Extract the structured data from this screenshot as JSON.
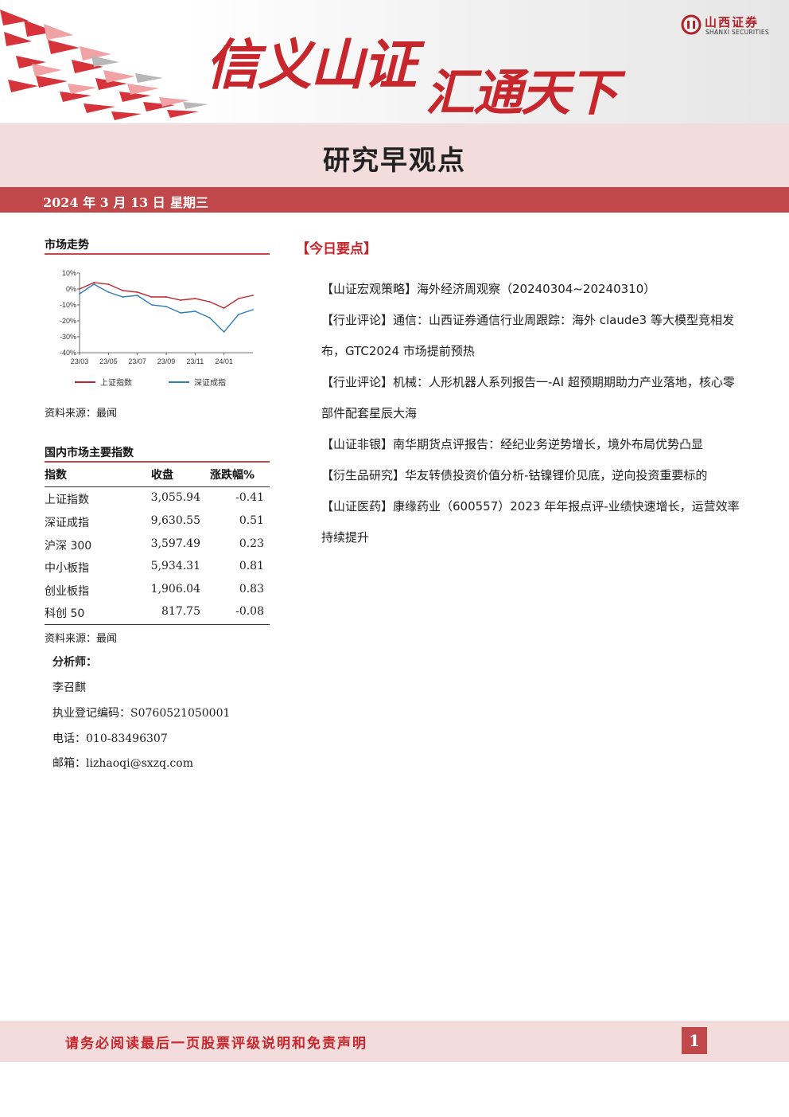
{
  "banner": {
    "slogan_left": "信义山证",
    "slogan_right": "汇通天下",
    "logo_name": "山西证券",
    "logo_sub": "SHANXI SECURITIES"
  },
  "report_title": "研究早观点",
  "date_line": {
    "date": "2024 年 3 月 13 日",
    "weekday": "星期三"
  },
  "market_trend": {
    "heading": "市场走势",
    "source": "资料来源：最闻",
    "chart_data": {
      "type": "line",
      "x": [
        "23/03",
        "23/04",
        "23/05",
        "23/06",
        "23/07",
        "23/08",
        "23/09",
        "23/10",
        "23/11",
        "23/12",
        "24/01",
        "24/02",
        "24/03"
      ],
      "xticks": [
        "23/03",
        "23/05",
        "23/07",
        "23/09",
        "23/11",
        "24/01"
      ],
      "yticks": [
        "10%",
        "0%",
        "-10%",
        "-20%",
        "-30%",
        "-40%"
      ],
      "ylim": [
        -40,
        10
      ],
      "series": [
        {
          "name": "上证指数",
          "color": "#c0262c",
          "values": [
            0,
            4,
            3,
            -1,
            -2,
            -5,
            -5,
            -7,
            -6,
            -8,
            -12,
            -6,
            -4
          ]
        },
        {
          "name": "深证成指",
          "color": "#2e7fb8",
          "values": [
            -3,
            3,
            -2,
            -5,
            -4,
            -10,
            -11,
            -15,
            -14,
            -18,
            -27,
            -16,
            -13
          ]
        }
      ]
    }
  },
  "index_table": {
    "heading": "国内市场主要指数",
    "columns": [
      "指数",
      "收盘",
      "涨跌幅%"
    ],
    "rows": [
      {
        "name": "上证指数",
        "close": "3,055.94",
        "chg": "-0.41"
      },
      {
        "name": "深证成指",
        "close": "9,630.55",
        "chg": "0.51"
      },
      {
        "name": "沪深 300",
        "close": "3,597.49",
        "chg": "0.23"
      },
      {
        "name": "中小板指",
        "close": "5,934.31",
        "chg": "0.81"
      },
      {
        "name": "创业板指",
        "close": "1,906.04",
        "chg": "0.83"
      },
      {
        "name": "科创 50",
        "close": "817.75",
        "chg": "-0.08"
      }
    ],
    "source": "资料来源：最闻"
  },
  "analyst": {
    "heading": "分析师：",
    "name": "李召麒",
    "cert_label": "执业登记编码：",
    "cert": "S0760521050001",
    "phone_label": "电话：",
    "phone": "010-83496307",
    "email_label": "邮箱：",
    "email": "lizhaoqi@sxzq.com"
  },
  "today": {
    "heading": "【今日要点】",
    "points": [
      "【山证宏观策略】海外经济周观察（20240304~20240310）",
      "【行业评论】通信：山西证券通信行业周跟踪：海外 claude3 等大模型竞相发布，GTC2024 市场提前预热",
      "【行业评论】机械：人形机器人系列报告一-AI 超预期期助力产业落地，核心零部件配套星辰大海",
      "【山证非银】南华期货点评报告：经纪业务逆势增长，境外布局优势凸显",
      "【衍生品研究】华友转债投资价值分析-钴镍锂价见底，逆向投资重要标的",
      "【山证医药】康缘药业（600557）2023 年年报点评-业绩快速增长，运营效率持续提升"
    ]
  },
  "footer": {
    "notice": "请务必阅读最后一页股票评级说明和免责声明",
    "page": "1"
  }
}
